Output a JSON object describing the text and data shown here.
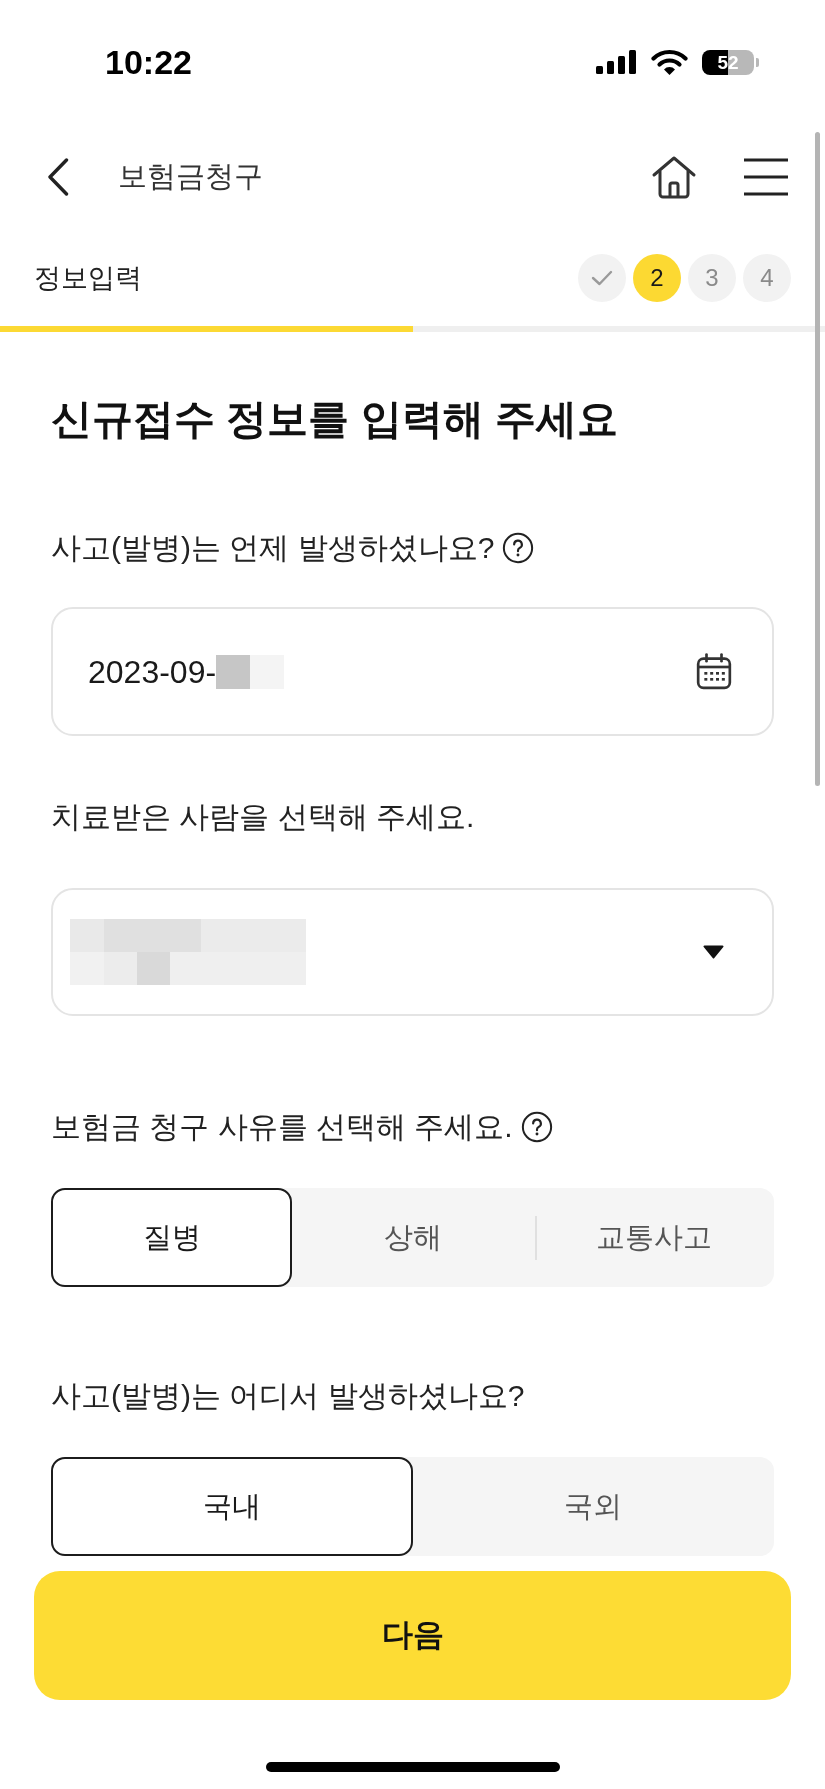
{
  "status_bar": {
    "time": "10:22",
    "battery": "52"
  },
  "header": {
    "title": "보험금청구"
  },
  "steps": {
    "title": "정보입력",
    "items": [
      {
        "kind": "done"
      },
      {
        "label": "2",
        "kind": "current"
      },
      {
        "label": "3",
        "kind": "upcoming"
      },
      {
        "label": "4",
        "kind": "upcoming"
      }
    ],
    "progress": {
      "level": 0.5
    }
  },
  "form": {
    "heading": "신규접수 정보를 입력해 주세요",
    "questions": [
      {
        "kind": "date",
        "label": "사고(발병)는 언제 발생하셨나요?",
        "help": true,
        "value": "2023-09-",
        "redacted": true
      },
      {
        "kind": "select",
        "label": "치료받은 사람을 선택해 주세요.",
        "redacted": true
      },
      {
        "kind": "segmented",
        "label": "보험금 청구 사유를 선택해 주세요.",
        "help": true,
        "options": [
          {
            "label": "질병",
            "selected": true
          },
          {
            "label": "상해",
            "selected": false
          },
          {
            "label": "교통사고",
            "selected": false
          }
        ]
      },
      {
        "kind": "segmented",
        "label": "사고(발병)는 어디서 발생하셨나요?",
        "options": [
          {
            "label": "국내",
            "selected": true
          },
          {
            "label": "국외",
            "selected": false
          }
        ]
      }
    ]
  },
  "next_button": {
    "label": "다음"
  }
}
